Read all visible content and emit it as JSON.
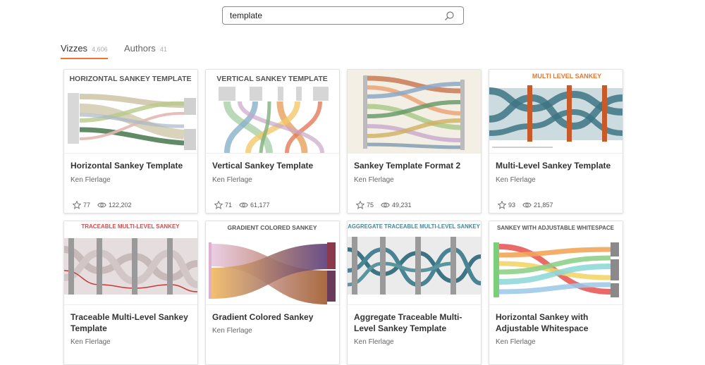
{
  "search": {
    "value": "template"
  },
  "tabs": [
    {
      "label": "Vizzes",
      "count": "4,606"
    },
    {
      "label": "Authors",
      "count": "41"
    }
  ],
  "cards": [
    {
      "thumb_title": "HORIZONTAL SANKEY TEMPLATE",
      "title": "Horizontal Sankey Template",
      "author": "Ken Flerlage",
      "favorites": "77",
      "views": "122,202"
    },
    {
      "thumb_title": "VERTICAL SANKEY TEMPLATE",
      "title": "Vertical Sankey Template",
      "author": "Ken Flerlage",
      "favorites": "71",
      "views": "61,177"
    },
    {
      "thumb_title": "",
      "title": "Sankey Template Format 2",
      "author": "Ken Flerlage",
      "favorites": "75",
      "views": "49,231"
    },
    {
      "thumb_title": "MULTI LEVEL SANKEY",
      "title": "Multi-Level Sankey Template",
      "author": "Ken Flerlage",
      "favorites": "93",
      "views": "21,857"
    },
    {
      "thumb_title": "TRACEABLE MULTI-LEVEL SANKEY",
      "title": "Traceable Multi-Level Sankey Template",
      "author": "Ken Flerlage"
    },
    {
      "thumb_title": "GRADIENT COLORED SANKEY",
      "title": "Gradient Colored Sankey",
      "author": "Ken Flerlage"
    },
    {
      "thumb_title": "AGGREGATE TRACEABLE MULTI-LEVEL SANKEY",
      "title": "Aggregate Traceable Multi-Level Sankey Template",
      "author": "Ken Flerlage"
    },
    {
      "thumb_title": "SANKEY WITH ADJUSTABLE WHITESPACE",
      "title": "Horizontal Sankey with Adjustable Whitespace",
      "author": "Ken Flerlage"
    }
  ],
  "colors": {
    "accent": "#e8762d",
    "thumb_orange": "#e8762d",
    "thumb_teal": "#3d8a9c"
  }
}
